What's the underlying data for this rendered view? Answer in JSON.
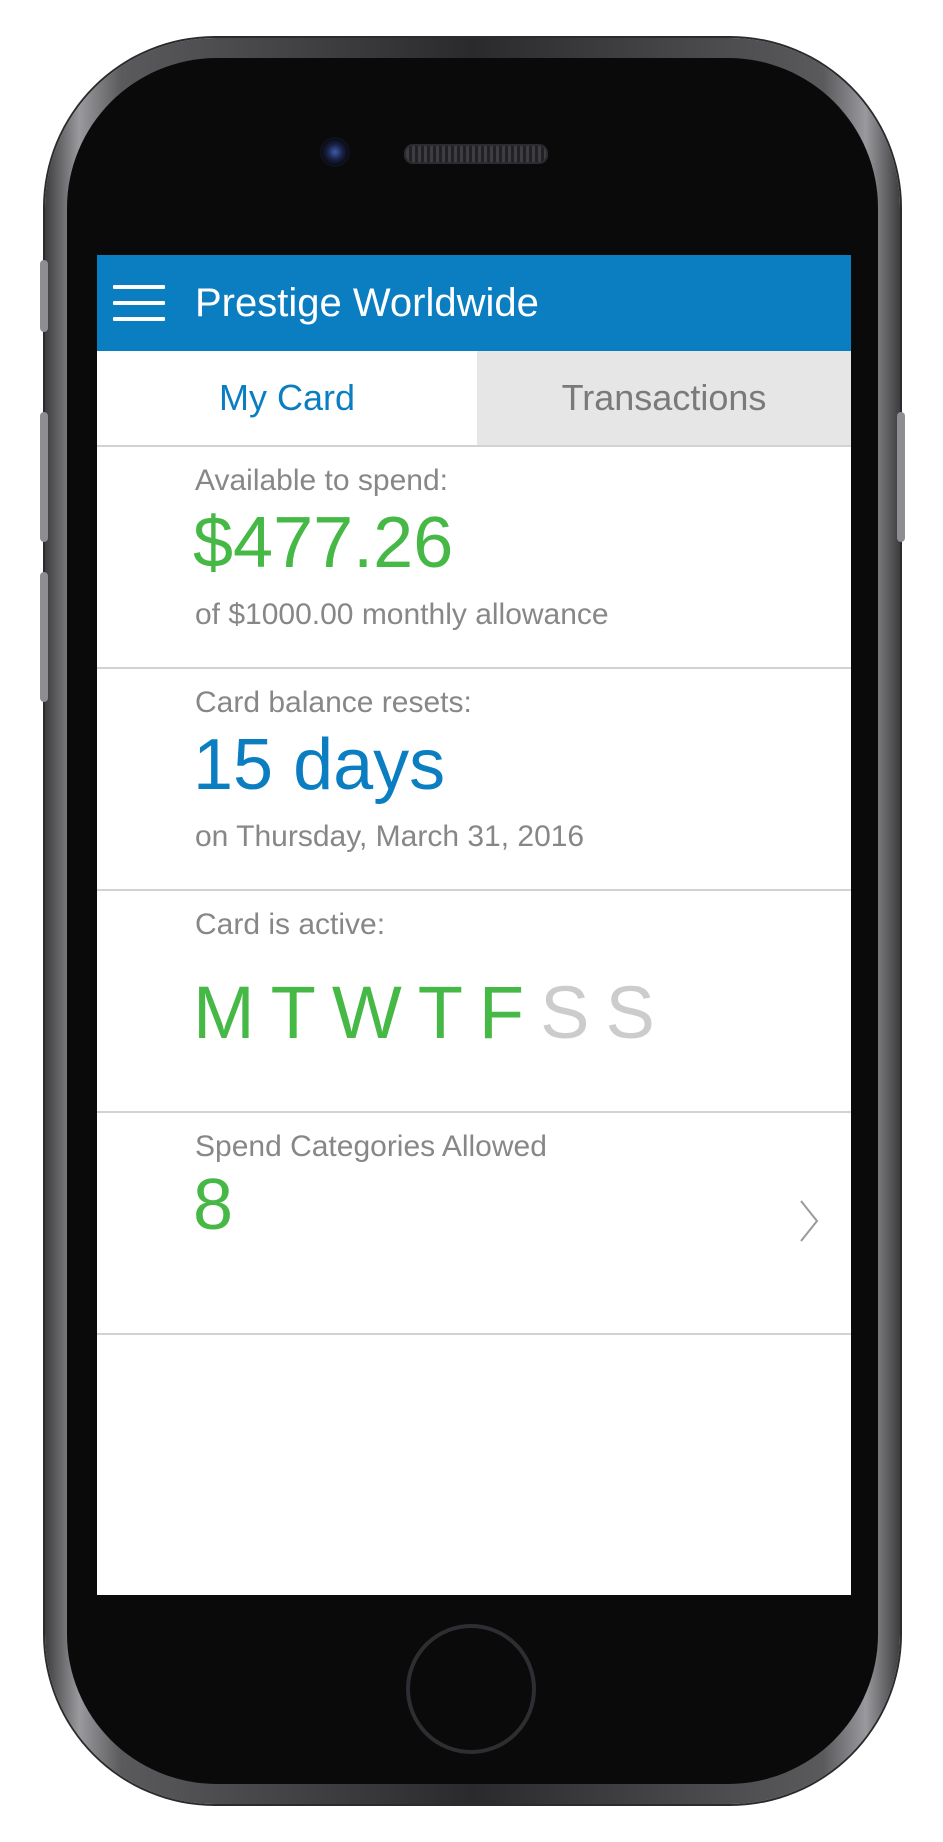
{
  "app": {
    "title": "Prestige Worldwide"
  },
  "tabs": [
    {
      "label": "My Card",
      "active": true
    },
    {
      "label": "Transactions",
      "active": false
    }
  ],
  "available": {
    "label": "Available to spend:",
    "amount": "$477.26",
    "note": "of $1000.00 monthly allowance"
  },
  "reset": {
    "label": "Card balance resets:",
    "value": "15 days",
    "note": "on Thursday, March 31, 2016"
  },
  "active": {
    "label": "Card is active:",
    "days": [
      {
        "letter": "M",
        "active": true
      },
      {
        "letter": "T",
        "active": true
      },
      {
        "letter": "W",
        "active": true
      },
      {
        "letter": "T",
        "active": true
      },
      {
        "letter": "F",
        "active": true
      },
      {
        "letter": "S",
        "active": false
      },
      {
        "letter": "S",
        "active": false
      }
    ]
  },
  "categories": {
    "label": "Spend Categories Allowed",
    "count": "8"
  },
  "colors": {
    "appbar": "#0a7ec1",
    "accent_blue": "#0a7ec1",
    "accent_green": "#46b846",
    "inactive_day": "#cccccc",
    "muted_text": "#878787"
  },
  "icons": {
    "menu": "hamburger-menu-icon",
    "chevron": "chevron-right-icon"
  }
}
